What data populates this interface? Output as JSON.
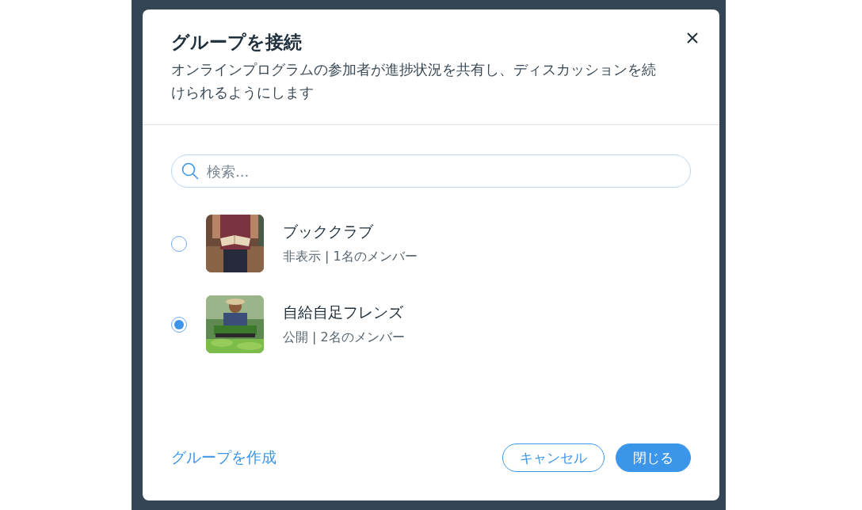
{
  "dialog": {
    "title": "グループを接続",
    "subtitle": "オンラインプログラムの参加者が進捗状況を共有し、ディスカッションを続けられるようにします",
    "search": {
      "placeholder": "検索..."
    },
    "groups": [
      {
        "name": "ブッククラブ",
        "details": "非表示 | 1名のメンバー",
        "selected": false
      },
      {
        "name": "自給自足フレンズ",
        "details": "公開 | 2名のメンバー",
        "selected": true
      }
    ],
    "create_link": "グループを作成",
    "buttons": [
      {
        "label": "キャンセル",
        "kind": "secondary"
      },
      {
        "label": "閉じる",
        "kind": "primary"
      }
    ]
  }
}
